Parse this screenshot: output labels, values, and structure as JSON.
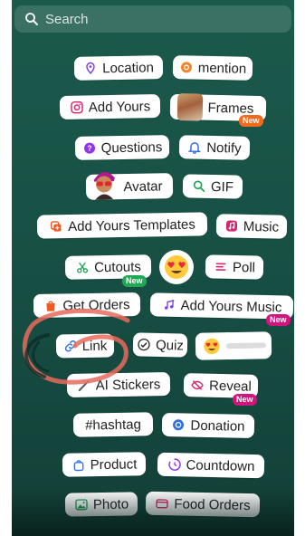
{
  "search": {
    "placeholder": "Search",
    "icon": "search-icon"
  },
  "stickers": {
    "location": {
      "label": "Location",
      "icon": "location-pin-icon",
      "color": "#7b3fe4"
    },
    "mention": {
      "label": "mention",
      "icon": "at-sign-icon",
      "color": "#f5832b"
    },
    "add_yours": {
      "label": "Add Yours",
      "icon": "camera-icon",
      "color": "#d6246e"
    },
    "frames": {
      "label": "Frames",
      "badge": "New",
      "badge_color": "#f26b1d"
    },
    "questions": {
      "label": "Questions",
      "icon": "question-icon",
      "color": "#9333ea"
    },
    "notify": {
      "label": "Notify",
      "icon": "bell-icon",
      "color": "#2f6fe4"
    },
    "avatar": {
      "label": "Avatar"
    },
    "gif": {
      "label": "GIF",
      "icon": "search-icon",
      "color": "#21a056"
    },
    "add_yours_templates": {
      "label": "Add Yours Templates",
      "icon": "template-icon",
      "color": "#ee5a24"
    },
    "music": {
      "label": "Music",
      "icon": "music-note-icon",
      "color": "#d6246e"
    },
    "cutouts": {
      "label": "Cutouts",
      "badge": "New",
      "badge_color": "#1fa855",
      "icon": "scissors-icon",
      "color": "#21a056"
    },
    "emoji_sticker": {
      "icon": "heart-eyes-emoji-icon"
    },
    "poll": {
      "label": "Poll",
      "icon": "poll-icon",
      "color": "#d6246e"
    },
    "get_orders": {
      "label": "Get Orders",
      "icon": "shopping-bag-icon",
      "color": "#ee5a24"
    },
    "add_yours_music": {
      "label": "Add Yours Music",
      "badge": "New",
      "badge_color": "#d0157c",
      "icon": "music-plus-icon",
      "color": "#7b3fe4"
    },
    "link": {
      "label": "Link",
      "icon": "link-icon",
      "color": "#2f6fe4"
    },
    "quiz": {
      "label": "Quiz",
      "icon": "check-circle-icon",
      "color": "#2a2a2a"
    },
    "slider": {
      "icon": "heart-eyes-emoji-icon"
    },
    "ai_stickers": {
      "label": "AI Stickers",
      "icon": "magic-wand-icon",
      "color": "#555555"
    },
    "reveal": {
      "label": "Reveal",
      "badge": "New",
      "badge_color": "#d0157c",
      "icon": "eye-slash-icon",
      "color": "#d6246e"
    },
    "hashtag": {
      "label": "#hashtag",
      "color": "#7b3fe4"
    },
    "donation": {
      "label": "Donation",
      "icon": "donation-icon",
      "color": "#2f6fe4"
    },
    "product": {
      "label": "Product",
      "icon": "product-bag-icon",
      "color": "#2f6fe4"
    },
    "countdown": {
      "label": "Countdown",
      "icon": "countdown-icon",
      "color": "#9333ea"
    },
    "photo": {
      "label": "Photo",
      "icon": "image-icon",
      "color": "#21a056"
    },
    "food_orders": {
      "label": "Food Orders",
      "icon": "food-orders-icon",
      "color": "#d6246e"
    }
  }
}
